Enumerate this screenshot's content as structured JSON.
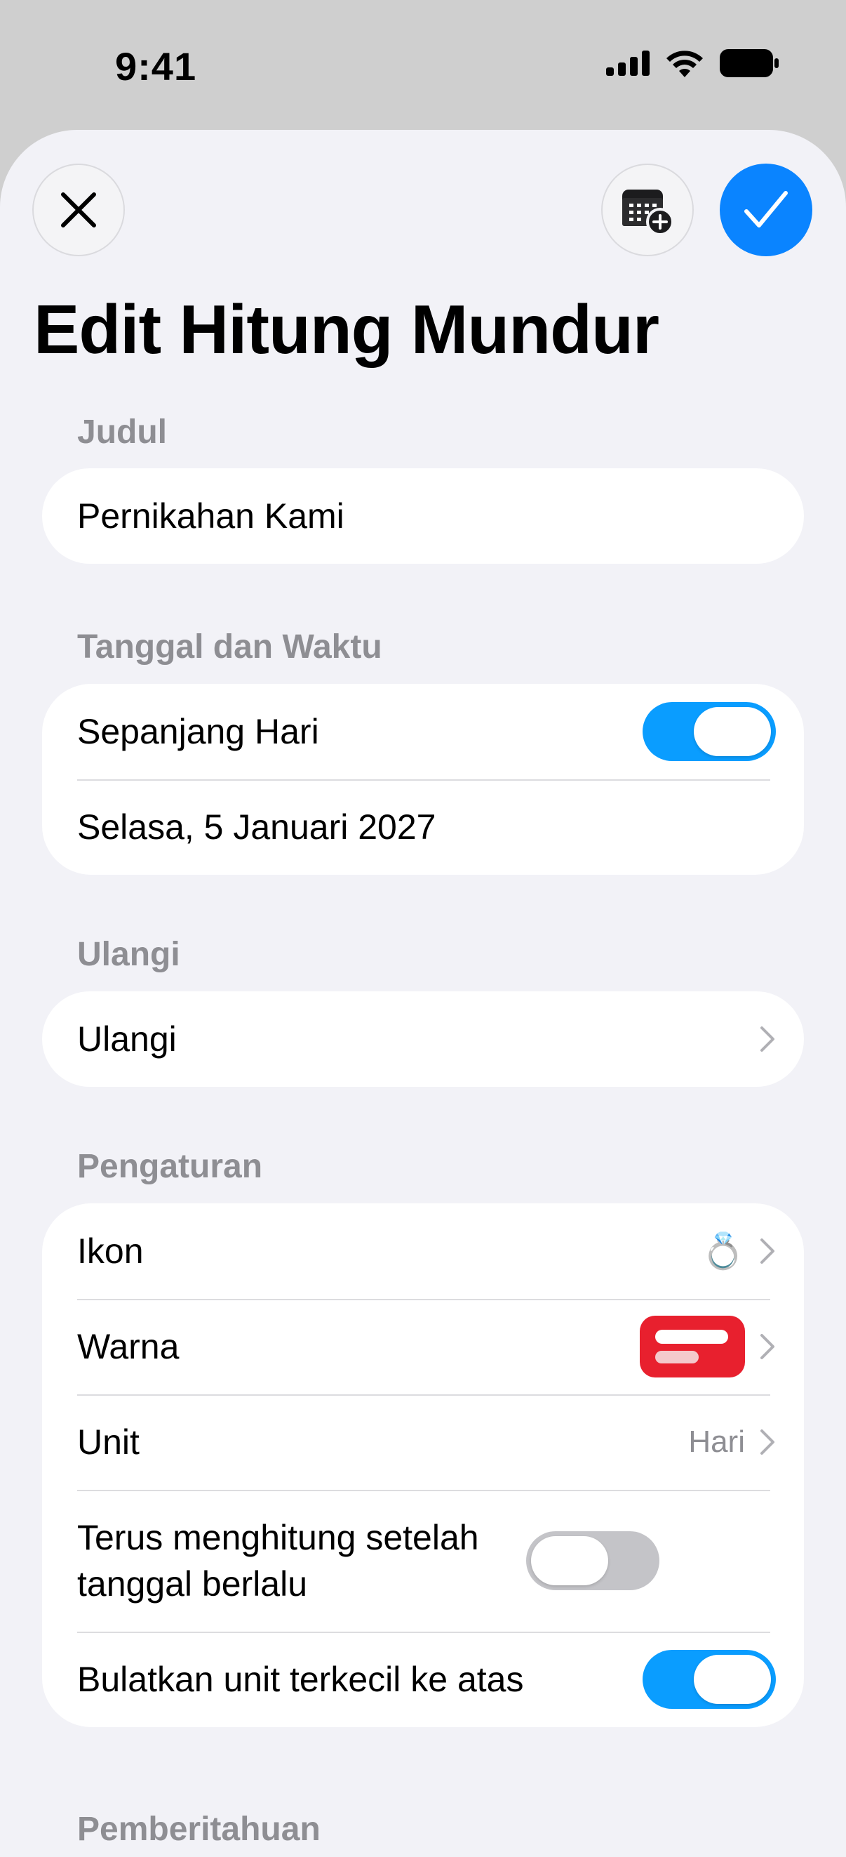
{
  "status_bar": {
    "time": "9:41",
    "icons": [
      "cellular-signal-icon",
      "wifi-icon",
      "battery-icon"
    ]
  },
  "header": {
    "close_icon": "close-icon",
    "calendar_icon": "calendar-add-icon",
    "confirm_icon": "checkmark-icon",
    "confirm_color": "#0a84ff"
  },
  "page": {
    "title": "Edit Hitung Mundur"
  },
  "sections": {
    "judul": {
      "label": "Judul",
      "value": "Pernikahan Kami"
    },
    "tanggal": {
      "label": "Tanggal dan Waktu",
      "all_day_label": "Sepanjang Hari",
      "all_day_on": true,
      "date_value": "Selasa, 5 Januari 2027"
    },
    "ulangi": {
      "label": "Ulangi",
      "row_label": "Ulangi"
    },
    "pengaturan": {
      "label": "Pengaturan",
      "icon_label": "Ikon",
      "icon_value": "💍",
      "color_label": "Warna",
      "color_value": "#e8202e",
      "unit_label": "Unit",
      "unit_value": "Hari",
      "keep_counting_label": "Terus menghitung setelah tanggal berlalu",
      "keep_counting_on": false,
      "round_up_label": "Bulatkan unit terkecil ke atas",
      "round_up_on": true
    },
    "pemberitahuan": {
      "label": "Pemberitahuan"
    }
  },
  "colors": {
    "accent": "#0a84ff",
    "toggle_on": "#0a9dff",
    "background": "#f2f2f7"
  }
}
